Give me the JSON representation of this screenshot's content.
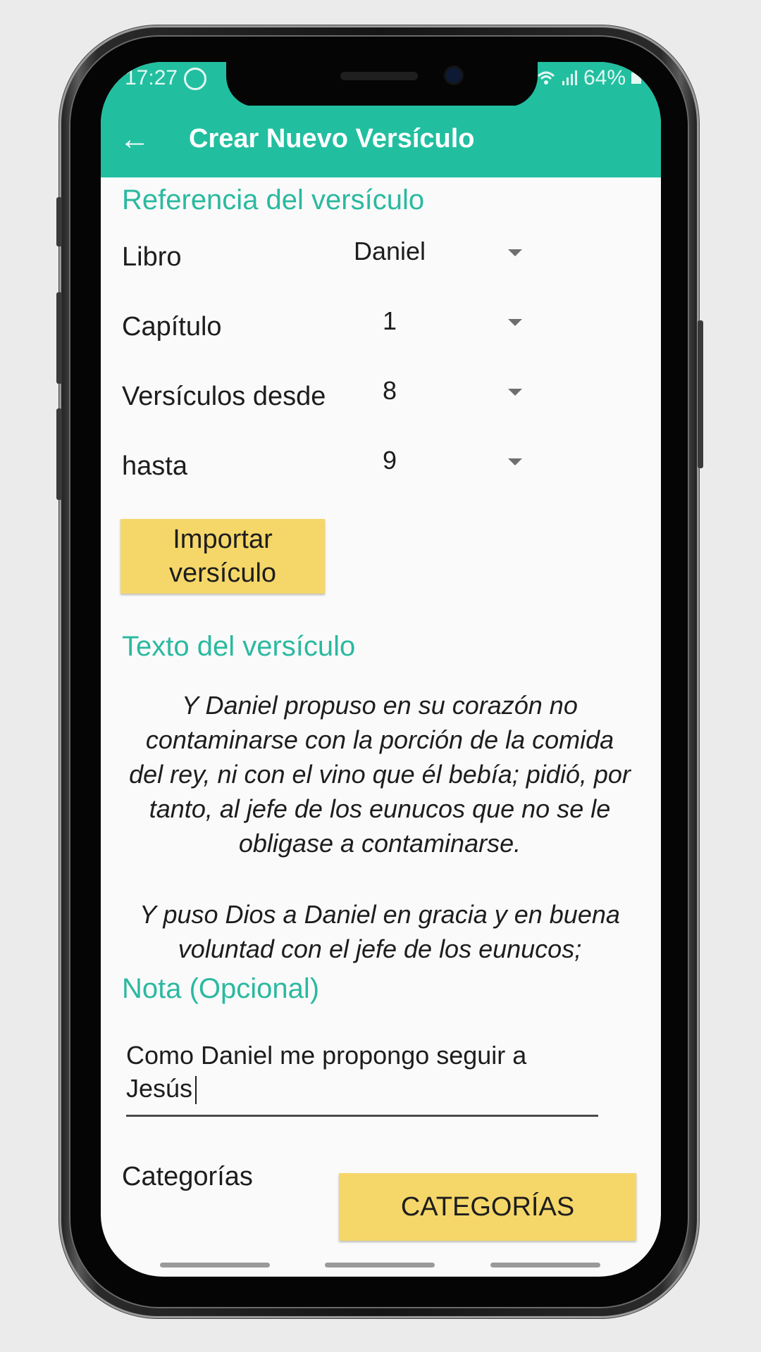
{
  "statusbar": {
    "time": "17:27",
    "battery": "64%",
    "icons": [
      "whatsapp-icon",
      "wifi-icon",
      "signal-icon",
      "battery-icon"
    ]
  },
  "appbar": {
    "back_icon": "arrow-left-icon",
    "title": "Crear Nuevo Versículo"
  },
  "reference": {
    "section_title": "Referencia del versículo",
    "rows": [
      {
        "label": "Libro",
        "value": "Daniel"
      },
      {
        "label": "Capítulo",
        "value": "1"
      },
      {
        "label": "Versículos desde",
        "value": "8"
      },
      {
        "label": "hasta",
        "value": "9"
      }
    ],
    "import_button": [
      "Importar",
      "versículo"
    ]
  },
  "verse_text": {
    "section_title": "Texto del versículo",
    "paragraphs": [
      [
        "Y Daniel propuso en su corazón no",
        "contaminarse con la porción de la comida",
        "del rey, ni con el vino que él bebía; pidió, por",
        "tanto, al jefe de los eunucos que no se le",
        "obligase a contaminarse."
      ],
      [
        "Y puso Dios a Daniel en gracia y en buena",
        "voluntad con el jefe de los eunucos;"
      ]
    ]
  },
  "note": {
    "section_title": "Nota (Opcional)",
    "value_lines": [
      "Como Daniel me propongo seguir a",
      "Jesús"
    ]
  },
  "categories": {
    "label": "Categorías",
    "button": "CATEGORÍAS"
  },
  "colors": {
    "accent": "#21bfa0",
    "section_title": "#2bb9a0",
    "button_yellow": "#f5d769",
    "background": "#fafafa"
  }
}
